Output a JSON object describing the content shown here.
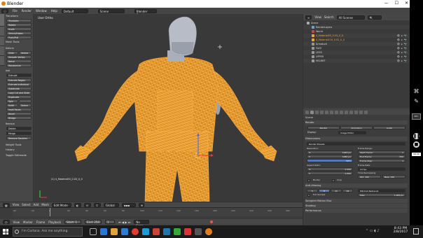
{
  "window": {
    "title": "Blender",
    "controls": [
      "—",
      "☐",
      "✕"
    ]
  },
  "menubar": {
    "items": [
      "File",
      "Render",
      "Window",
      "Help"
    ],
    "layout": "Default",
    "scene": "Scene",
    "engine": "Blender Render"
  },
  "toolshelf": {
    "transform_header": "Transform",
    "transform": [
      "Translate",
      "Rotate",
      "Scale",
      "Shrink/Fatten",
      "Push/Pull"
    ],
    "mesh_tools_header": "Mesh Tools",
    "deform_header": "Deform",
    "deform": [
      "Slide",
      "Vertex",
      "Smooth Vertex",
      "Noise",
      "Randomize"
    ],
    "add_header": "Add",
    "add_select": "Extrude",
    "add": [
      "Extrude Region",
      "Extrude Individual",
      "Subdivide",
      "Loop Cut and Slide",
      "Duplicate",
      "Spin",
      "Knife",
      "Select",
      "Inset Faces",
      "Bevel",
      "Bridge"
    ],
    "remove_header": "Remove",
    "remove": [
      "Delete",
      "Merge",
      "Remove Doubles"
    ],
    "weight_tools": "Weight Tools",
    "history": "History",
    "toggle_editmode": "Toggle Editmode"
  },
  "viewport": {
    "title": "User Ortho",
    "object_label": "(1) 4_Material53_0.03_0_0"
  },
  "viewport_header": {
    "items": [
      "View",
      "Select",
      "Add",
      "Mesh"
    ],
    "mode": "Edit Mode",
    "pivot": "Global"
  },
  "timeline": {
    "ticks": [
      "-40",
      "-20",
      "0",
      "20",
      "40",
      "60",
      "80",
      "100",
      "120",
      "140",
      "160",
      "180",
      "200",
      "220",
      "240",
      "260"
    ],
    "items": [
      "View",
      "Marker",
      "Frame",
      "Playback"
    ],
    "start": "Start: 1",
    "end": "End: 250",
    "current": "1",
    "sync": "No Sync"
  },
  "outliner": {
    "header_items": [
      "View",
      "Search",
      "All Scenes"
    ],
    "rows": [
      {
        "label": "Scene",
        "hl": false,
        "indent": 0
      },
      {
        "label": "RenderLayers",
        "hl": false,
        "indent": 1
      },
      {
        "label": "World",
        "hl": false,
        "indent": 1
      },
      {
        "label": "4_Material53_0.03_0_0",
        "hl": true,
        "indent": 1
      },
      {
        "label": "4_Material116_0.02_0_0",
        "hl": true,
        "indent": 1
      },
      {
        "label": "Armature",
        "hl": false,
        "indent": 1
      },
      {
        "label": "FACE",
        "hl": false,
        "indent": 1
      },
      {
        "label": "LEGS",
        "hl": false,
        "indent": 1
      },
      {
        "label": "UPPER",
        "hl": false,
        "indent": 1
      },
      {
        "label": "HELMET",
        "hl": false,
        "indent": 1
      }
    ]
  },
  "properties": {
    "scene": "Scene",
    "render_header": "Render",
    "render_buttons": [
      "Render",
      "Animation",
      "Audio"
    ],
    "display_label": "Display:",
    "display_value": "Image Editor",
    "dimensions_header": "Dimensions",
    "render_presets": "Render Presets",
    "resolution_label": "Resolution:",
    "res_x": "X:",
    "res_x_val": "1920 px",
    "res_y": "Y:",
    "res_y_val": "1080 px",
    "res_pct": "50%",
    "frame_range_label": "Frame Range:",
    "start_frame": "Start Frame:",
    "start_frame_val": "1",
    "end_frame": "End Frame:",
    "end_frame_val": "250",
    "frame_step": "Frame Step:",
    "frame_step_val": "1",
    "aspect_label": "Aspect Ratio:",
    "aspect_x": "X:",
    "aspect_x_val": "1.000",
    "aspect_y": "Y:",
    "aspect_y_val": "1.000",
    "frame_rate_label": "Frame Rate:",
    "frame_rate": "24 fps",
    "time_remap": "Time Remapping:",
    "old": "Old: 100",
    "new": "New: 100",
    "border": "Border",
    "crop": "Crop",
    "anti_aliasing": "Anti-Aliasing",
    "aa_values": [
      "5",
      "8",
      "11",
      "16"
    ],
    "aa_filter": "Mitchell-Netravali",
    "full_sample": "Full Sample",
    "aa_size": "Size:",
    "aa_size_val": "1.000 px",
    "motion_blur": "Sampled Motion Blur",
    "shading": "Shading",
    "performance": "Performance"
  },
  "taskbar": {
    "search_placeholder": "I'm Cortana. Ask me anything.",
    "time": "8:43 PM",
    "date": "2/8/2017"
  },
  "colors": {
    "wire_orange": "#f59a1f",
    "selected_text": "#f3a33c",
    "blender_bg": "#3c3c3c",
    "taskbar": "#1b1b1b"
  }
}
